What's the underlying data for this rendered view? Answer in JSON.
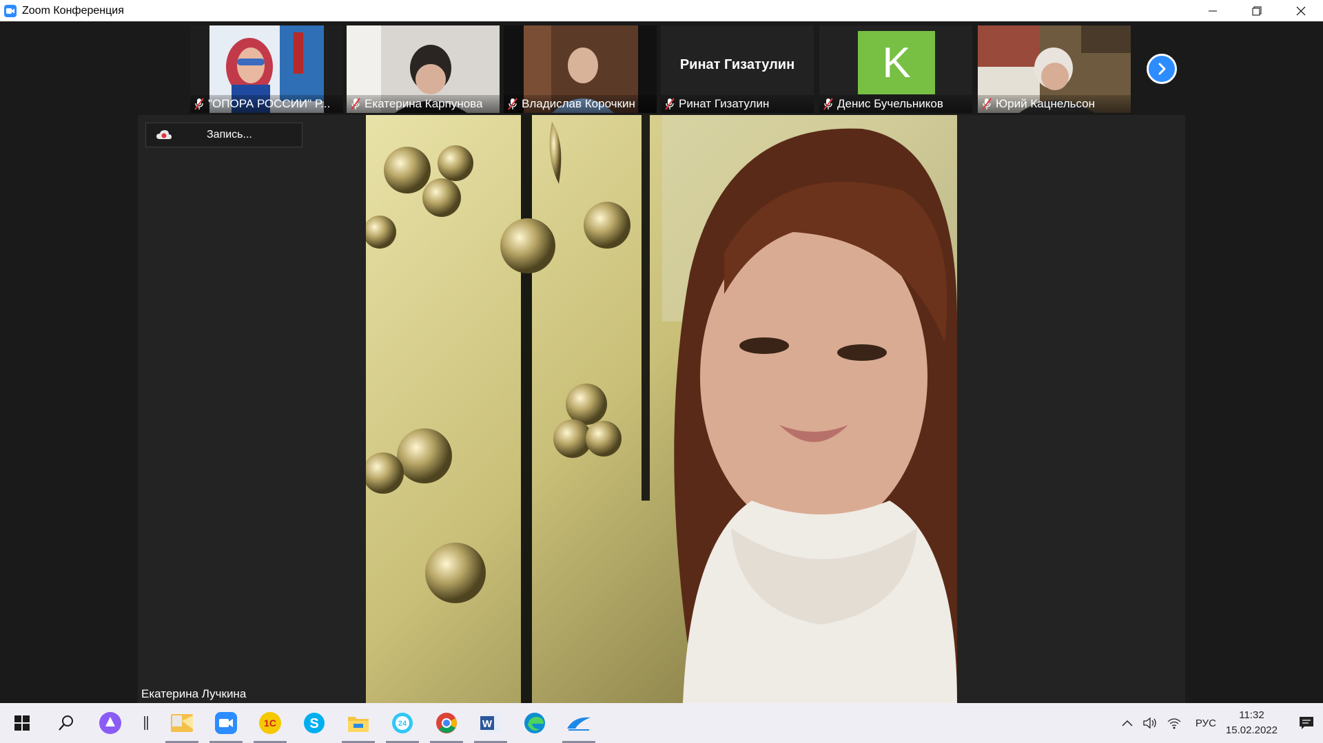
{
  "window": {
    "title": "Zoom Конференция"
  },
  "participants": [
    {
      "name": "\"ОПОРА РОССИИ\" Р...",
      "muted": true,
      "video": "photo"
    },
    {
      "name": "Екатерина Карпунова",
      "muted": true,
      "video": "photo"
    },
    {
      "name": "Владислав Корочкин",
      "muted": true,
      "video": "photo"
    },
    {
      "name": "Ринат Гизатулин",
      "muted": true,
      "video": "off",
      "display_name": "Ринат Гизатулин"
    },
    {
      "name": "Денис Бучельников",
      "muted": true,
      "video": "avatar",
      "avatar_letter": "K",
      "avatar_color": "#77c044"
    },
    {
      "name": "Юрий Кацнельсон",
      "muted": true,
      "video": "photo"
    }
  ],
  "recording": {
    "label": "Запись..."
  },
  "active_speaker": {
    "name": "Екатерина Лучкина"
  },
  "taskbar": {
    "apps": [
      "start-icon",
      "search-icon",
      "cortana-icon",
      "divider-icon",
      "outlook-icon",
      "zoom-icon",
      "1c-icon",
      "skype-icon",
      "explorer-icon",
      "bitrix24-icon",
      "chrome-icon",
      "word-icon",
      "edge-icon",
      "app-icon"
    ],
    "language": "РУС",
    "time": "11:32",
    "date": "15.02.2022"
  },
  "colors": {
    "accent": "#2d8cff",
    "muted_mic": "#e0363b"
  }
}
